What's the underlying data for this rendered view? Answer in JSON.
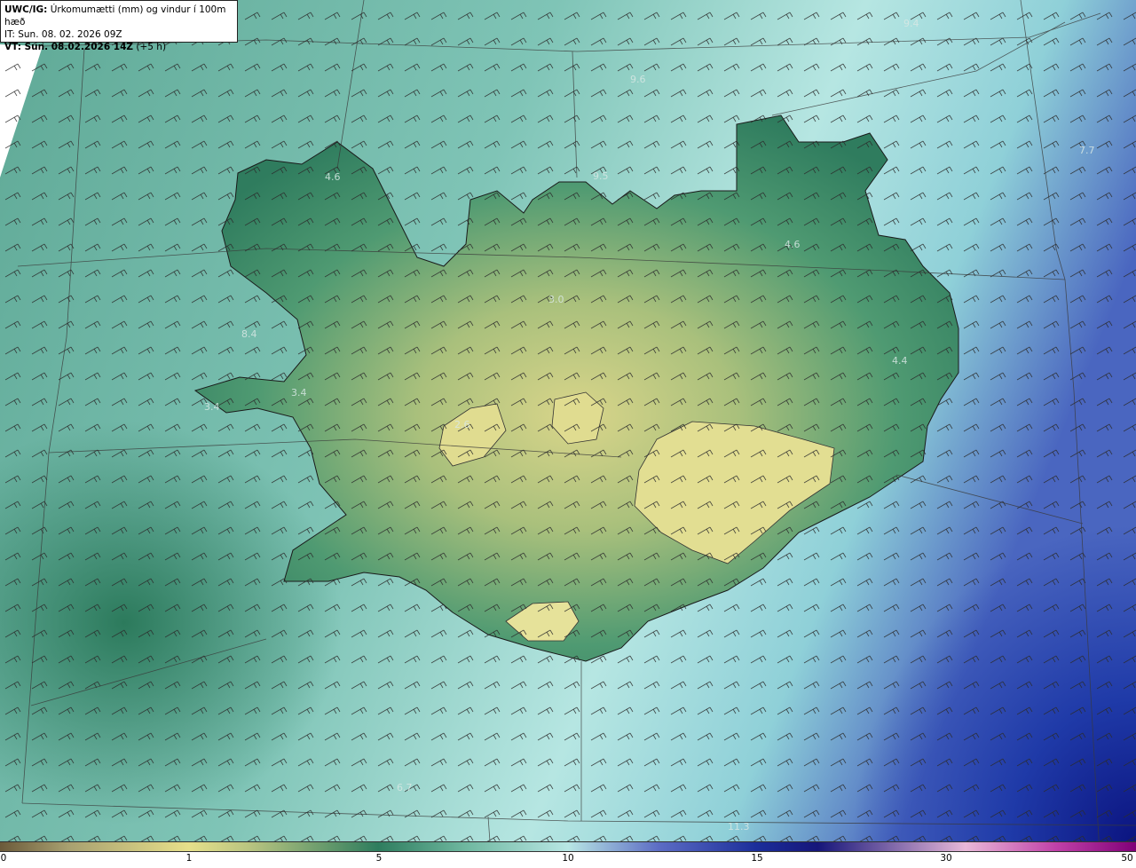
{
  "header": {
    "product": "UWC/IG:",
    "title": "Úrkomumætti (mm) og vindur í 100m hæð",
    "initial_time": "IT: Sun. 08. 02. 2026 09Z",
    "valid_time": "VT: Sun. 08.02.2026 14Z",
    "lead": "(+5 h)"
  },
  "map_labels": [
    "9.4",
    "9.6",
    "4.6",
    "9.5",
    "4.6",
    "3.0",
    "7.7",
    "4.4",
    "3.4",
    "3.4",
    "6.7",
    "11.3",
    "8.4",
    "2.6"
  ],
  "legend": {
    "ticks": [
      "0",
      "1",
      "5",
      "10",
      "15",
      "30",
      "50"
    ],
    "colors": {
      "dry": "#6b5a3a",
      "light": "#e6e08a",
      "mid": "#2e7d5e",
      "moist": "#b8e6e4",
      "heavy": "#1b2e9a",
      "extreme": "#800078"
    }
  }
}
